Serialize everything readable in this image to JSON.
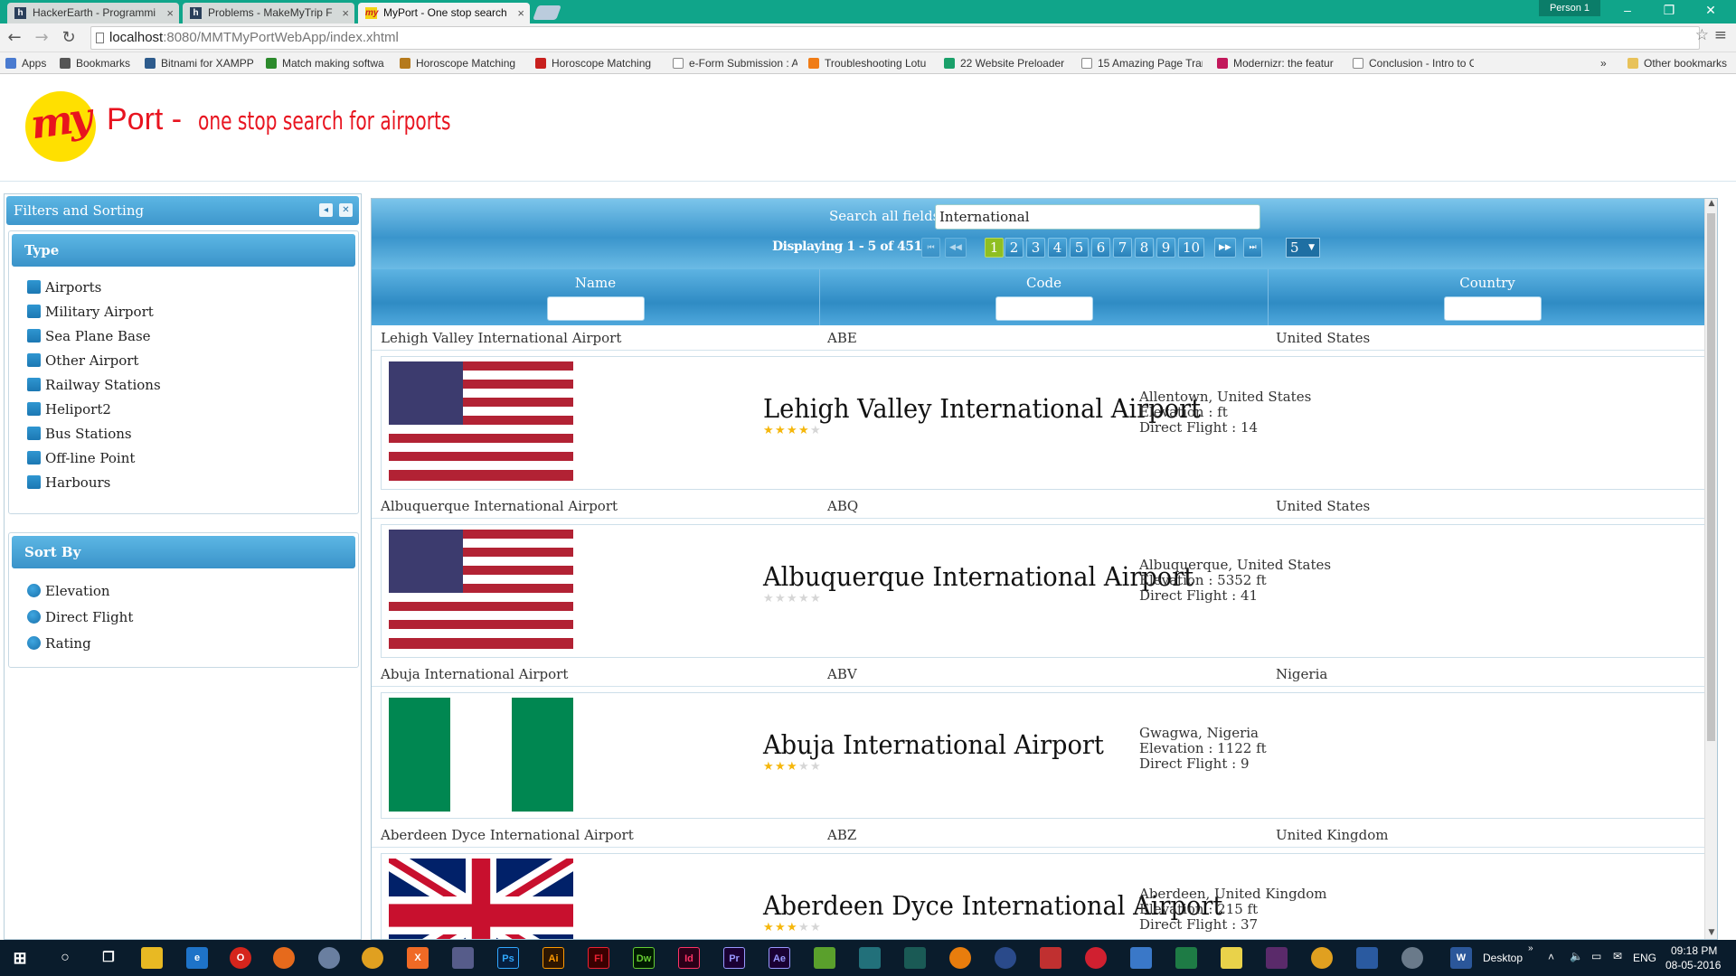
{
  "browser": {
    "tabs": [
      {
        "label": "HackerEarth - Programmi",
        "fav": "h"
      },
      {
        "label": "Problems - MakeMyTrip F",
        "fav": "h"
      },
      {
        "label": "MyPort - One stop search",
        "fav": "my"
      }
    ],
    "person": "Person 1",
    "url_host": "localhost",
    "url_path": ":8080/MMTMyPortWebApp/index.xhtml",
    "bookmarks": [
      {
        "label": "Apps",
        "color": "#4a7bd0"
      },
      {
        "label": "Bookmarks",
        "color": "#555555"
      },
      {
        "label": "Bitnami for XAMPP",
        "color": "#2d5b8c"
      },
      {
        "label": "Match making softwa",
        "color": "#2c8a2c"
      },
      {
        "label": "Horoscope Matching",
        "color": "#b57a1c"
      },
      {
        "label": "Horoscope Matching",
        "color": "#c8201e"
      },
      {
        "label": "e-Form Submission : A",
        "color": "#888888"
      },
      {
        "label": "Troubleshooting Lotu",
        "color": "#f07c16"
      },
      {
        "label": "22 Website Preloader",
        "color": "#1aa06a"
      },
      {
        "label": "15 Amazing Page Tran",
        "color": "#888888"
      },
      {
        "label": "Modernizr: the featur",
        "color": "#c2185b"
      },
      {
        "label": "Conclusion - Intro to C",
        "color": "#888888"
      }
    ],
    "other_bookmarks": "Other bookmarks"
  },
  "header": {
    "logo_text": "my",
    "brand": "Port -",
    "tagline": "one stop search for airports"
  },
  "filters": {
    "title": "Filters and Sorting",
    "type_title": "Type",
    "types": [
      "Airports",
      "Military Airport",
      "Sea Plane Base",
      "Other Airport",
      "Railway Stations",
      "Heliport2",
      "Bus Stations",
      "Off-line Point",
      "Harbours"
    ],
    "sort_title": "Sort By",
    "sorts": [
      "Elevation",
      "Direct Flight",
      "Rating"
    ]
  },
  "grid": {
    "search_label": "Search all fields :",
    "search_value": "International",
    "displaying": "Displaying 1 - 5 of 451",
    "pages": [
      "1",
      "2",
      "3",
      "4",
      "5",
      "6",
      "7",
      "8",
      "9",
      "10"
    ],
    "current_page": "1",
    "rows_per_page": "5",
    "columns": [
      "Name",
      "Code",
      "Country"
    ],
    "rows": [
      {
        "name": "Lehigh Valley International Airport",
        "code": "ABE",
        "country": "United States",
        "location": "Allentown, United States",
        "elevation": "Elevation : ft",
        "direct_flight": "Direct Flight : 14",
        "rating": 4,
        "flag": "us"
      },
      {
        "name": "Albuquerque International Airport",
        "code": "ABQ",
        "country": "United States",
        "location": "Albuquerque, United States",
        "elevation": "Elevation : 5352 ft",
        "direct_flight": "Direct Flight : 41",
        "rating": 0,
        "flag": "us"
      },
      {
        "name": "Abuja International Airport",
        "code": "ABV",
        "country": "Nigeria",
        "location": "Gwagwa, Nigeria",
        "elevation": "Elevation : 1122 ft",
        "direct_flight": "Direct Flight : 9",
        "rating": 3,
        "flag": "ng"
      },
      {
        "name": "Aberdeen Dyce International Airport",
        "code": "ABZ",
        "country": "United Kingdom",
        "location": "Aberdeen, United Kingdom",
        "elevation": "Elevation : 215 ft",
        "direct_flight": "Direct Flight : 37",
        "rating": 3,
        "flag": "gb"
      }
    ]
  },
  "taskbar": {
    "desktop": "Desktop",
    "lang": "ENG",
    "time": "09:18 PM",
    "date": "08-05-2016"
  }
}
